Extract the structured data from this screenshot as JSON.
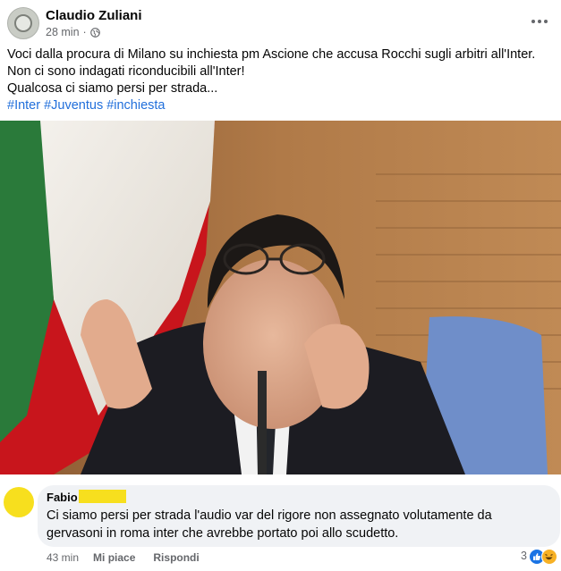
{
  "post": {
    "author": "Claudio Zuliani",
    "time": "28 min",
    "separator": "·",
    "privacy_icon": "globe-icon",
    "more_icon": "more-horizontal-icon",
    "text_lines": [
      "Voci dalla procura di Milano su inchiesta pm Ascione che accusa Rocchi sugli arbitri all'Inter.",
      "Non ci sono indagati riconducibili all'Inter!",
      "Qualcosa ci siamo persi per strada..."
    ],
    "hashtags": [
      "#Inter",
      "#Juventus",
      "#inchiesta"
    ]
  },
  "comment": {
    "author": "Fabio",
    "text_lines": [
      "Ci siamo persi per strada l'audio var del rigore non assegnato volutamente da",
      "gervasoni in roma inter che avrebbe portato poi allo scudetto."
    ],
    "time": "43 min",
    "like_label": "Mi piace",
    "reply_label": "Rispondi",
    "reaction_count": "3",
    "reactions": [
      "like-icon",
      "haha-icon"
    ]
  },
  "colors": {
    "link": "#216fdb",
    "meta": "#65676b",
    "bubble": "#f0f2f5",
    "redaction": "#f7df1e",
    "like": "#1b74e4"
  }
}
